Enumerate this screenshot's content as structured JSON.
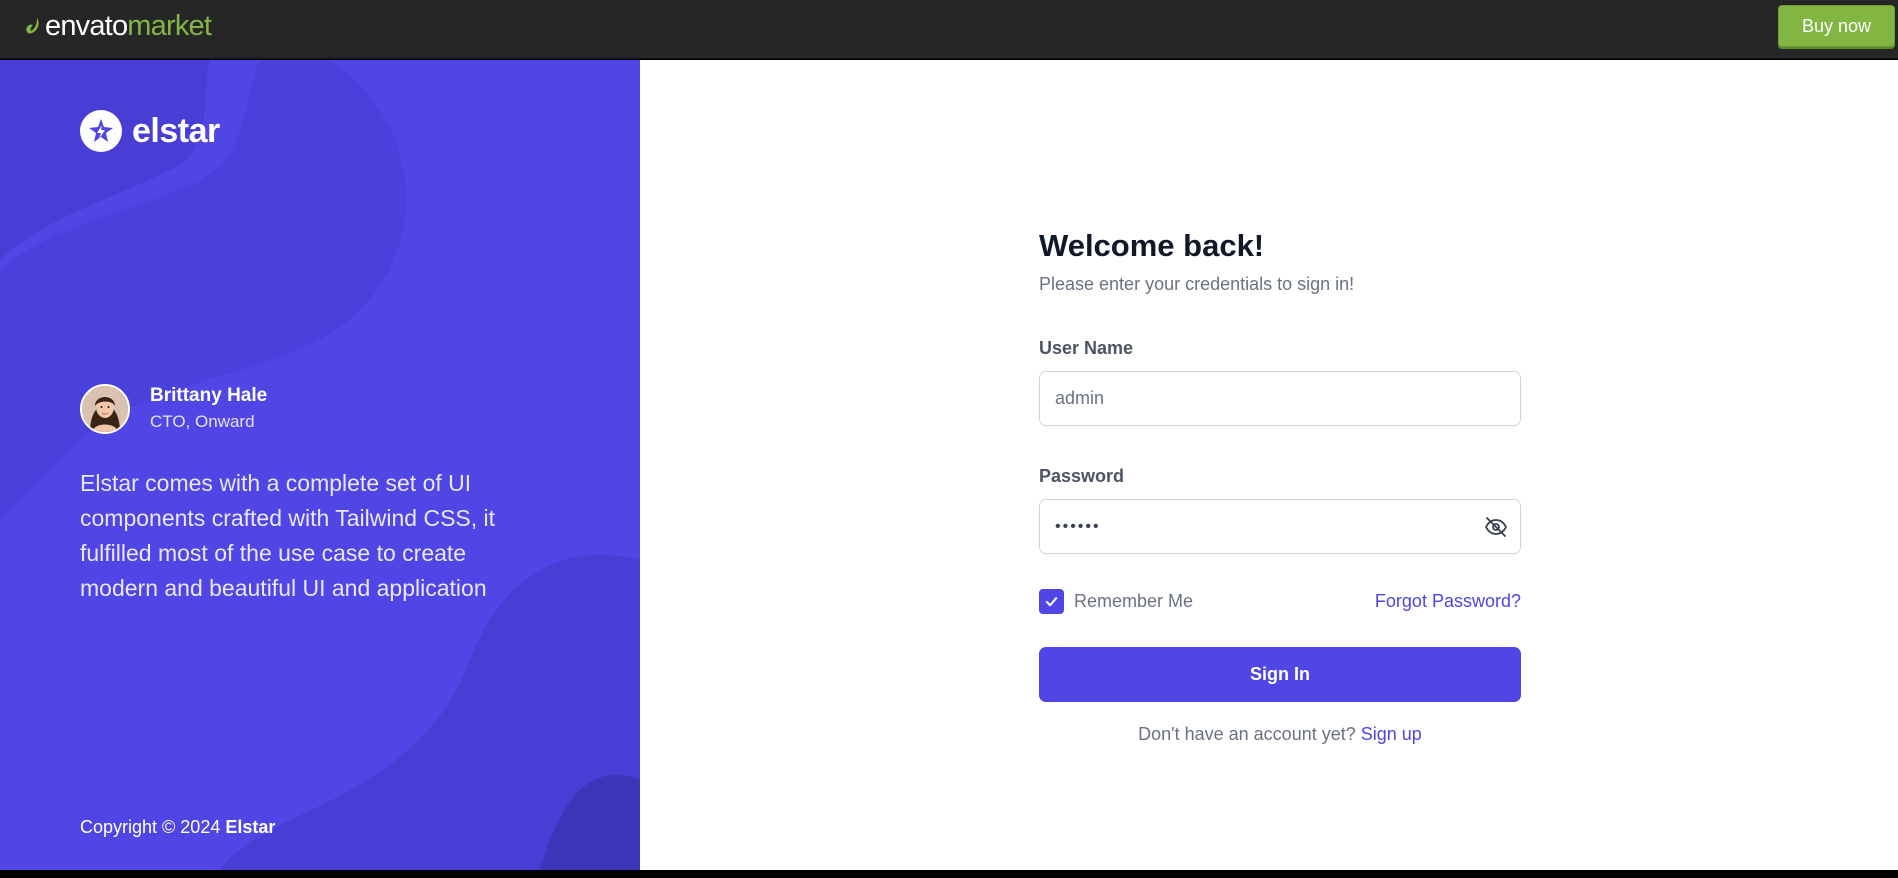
{
  "envato": {
    "logo_envato": "envato",
    "logo_market": "market",
    "buy_now_label": "Buy now",
    "brand_color": "#82b541"
  },
  "brand": {
    "name": "elstar",
    "primary_color": "#4f46e5"
  },
  "testimonial": {
    "name": "Brittany Hale",
    "role": "CTO, Onward",
    "quote": "Elstar comes with a complete set of UI components crafted with Tailwind CSS, it fulfilled most of the use case to create modern and beautiful UI and application"
  },
  "footer": {
    "copyright_prefix": "Copyright © 2024",
    "copyright_brand": "Elstar"
  },
  "login": {
    "title": "Welcome back!",
    "subtitle": "Please enter your credentials to sign in!",
    "username_label": "User Name",
    "username_value": "admin",
    "password_label": "Password",
    "password_masked": "••••••",
    "remember_label": "Remember Me",
    "remember_checked": true,
    "forgot_label": "Forgot Password?",
    "signin_label": "Sign In",
    "signup_prompt": "Don't have an account yet?",
    "signup_link": "Sign up"
  }
}
